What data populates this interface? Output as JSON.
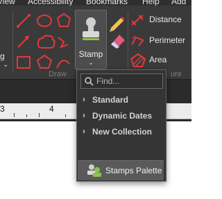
{
  "menu": {
    "items": [
      "View",
      "Accessibility",
      "Bookmarks",
      "Help",
      "Add"
    ]
  },
  "ribbon": {
    "draw_group_label": "Draw",
    "measure_group_label": "ure",
    "left_partial_label": "g",
    "stamp_label": "Stamp",
    "measure_tools": [
      {
        "label": "Distance",
        "icon": "distance-icon"
      },
      {
        "label": "Perimeter",
        "icon": "perimeter-icon"
      },
      {
        "label": "Area",
        "icon": "area-icon"
      }
    ]
  },
  "ruler": {
    "numbers": [
      "3",
      "4"
    ]
  },
  "dropdown": {
    "search_placeholder": "Find...",
    "items": [
      "Standard",
      "Dynamic Dates",
      "New Collection"
    ],
    "footer_label": "Stamps Palette"
  },
  "colors": {
    "accent_red": "#e03a3a",
    "ribbon_bg": "#3a3a3a",
    "dropdown_bg": "#353535"
  }
}
